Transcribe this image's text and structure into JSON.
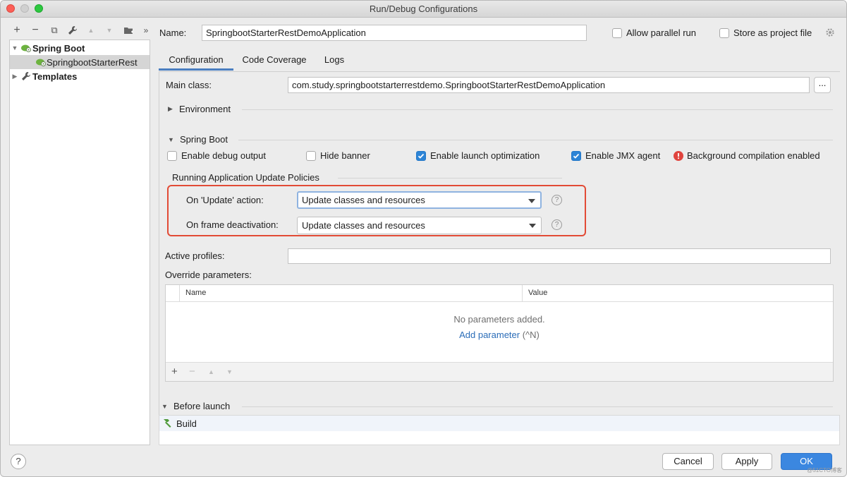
{
  "window": {
    "title": "Run/Debug Configurations"
  },
  "toolbar": {
    "add": "+",
    "remove": "−",
    "copy": "⧉",
    "edit": "🔧",
    "up": "▲",
    "down": "▼",
    "folder": "▣",
    "more": "»"
  },
  "tree": {
    "items": [
      {
        "label": "Spring Boot",
        "arrow": "▼",
        "icon": "spring-boot-icon"
      },
      {
        "label": "SpringbootStarterRest",
        "icon": "spring-boot-config-icon"
      },
      {
        "label": "Templates",
        "arrow": "▶",
        "icon": "wrench-icon"
      }
    ]
  },
  "header": {
    "name_label": "Name:",
    "name_value": "SpringbootStarterRestDemoApplication",
    "allow_parallel_label": "Allow parallel run",
    "allow_parallel_checked": false,
    "store_project_label": "Store as project file",
    "store_project_checked": false
  },
  "tabs": [
    {
      "label": "Configuration",
      "active": true
    },
    {
      "label": "Code Coverage",
      "active": false
    },
    {
      "label": "Logs",
      "active": false
    }
  ],
  "config": {
    "main_class_label": "Main class:",
    "main_class_value": "com.study.springbootstarterrestdemo.SpringbootStarterRestDemoApplication",
    "ellipsis": "...",
    "environment_label": "Environment",
    "spring_boot_label": "Spring Boot",
    "options": [
      {
        "label": "Enable debug output",
        "checked": false
      },
      {
        "label": "Hide banner",
        "checked": false
      },
      {
        "label": "Enable launch optimization",
        "checked": true
      },
      {
        "label": "Enable JMX agent",
        "checked": true
      }
    ],
    "warning_label": "Background compilation enabled",
    "policies_label": "Running Application Update Policies",
    "update_action_label": "On 'Update' action:",
    "update_action_value": "Update classes and resources",
    "frame_deactivation_label": "On frame deactivation:",
    "frame_deactivation_value": "Update classes and resources",
    "help_glyph": "?",
    "active_profiles_label": "Active profiles:",
    "active_profiles_value": "",
    "override_label": "Override parameters:",
    "params": {
      "col_name": "Name",
      "col_value": "Value",
      "empty_text": "No parameters added.",
      "add_link": "Add parameter",
      "add_shortcut": " (^N)",
      "footer_add": "+",
      "footer_remove": "−",
      "footer_up": "▲",
      "footer_down": "▼"
    },
    "before_launch_label": "Before launch",
    "build_label": "Build"
  },
  "footer": {
    "help": "?",
    "cancel": "Cancel",
    "apply": "Apply",
    "ok": "OK",
    "watermark": "@51CTO博客"
  },
  "colors": {
    "accent": "#3b87e0",
    "highlight_border": "#e24b36",
    "link": "#2b6db8",
    "error": "#e0443e"
  }
}
